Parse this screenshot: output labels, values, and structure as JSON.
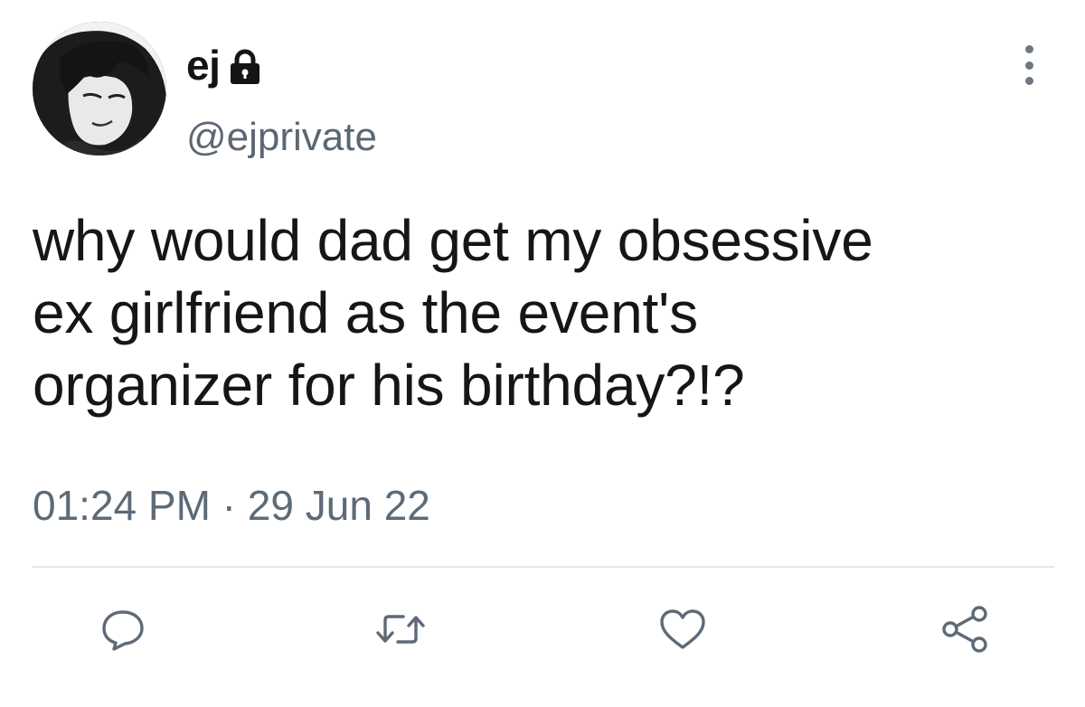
{
  "tweet": {
    "display_name": "ej",
    "handle": "@ejprivate",
    "text": "why would dad get my obsessive\nex girlfriend as the event's\norganizer for his birthday?!?",
    "time": "01:24 PM",
    "separator": " · ",
    "date": "29 Jun 22"
  },
  "icons": {
    "lock": "lock-icon",
    "more": "more-vertical-icon",
    "reply": "reply-icon",
    "retweet": "retweet-icon",
    "like": "heart-icon",
    "share": "share-icon"
  },
  "colors": {
    "text": "#161616",
    "secondary": "#5d6a77",
    "icon": "#5d6a77",
    "divider": "#e3e7ea",
    "background": "#ffffff"
  }
}
